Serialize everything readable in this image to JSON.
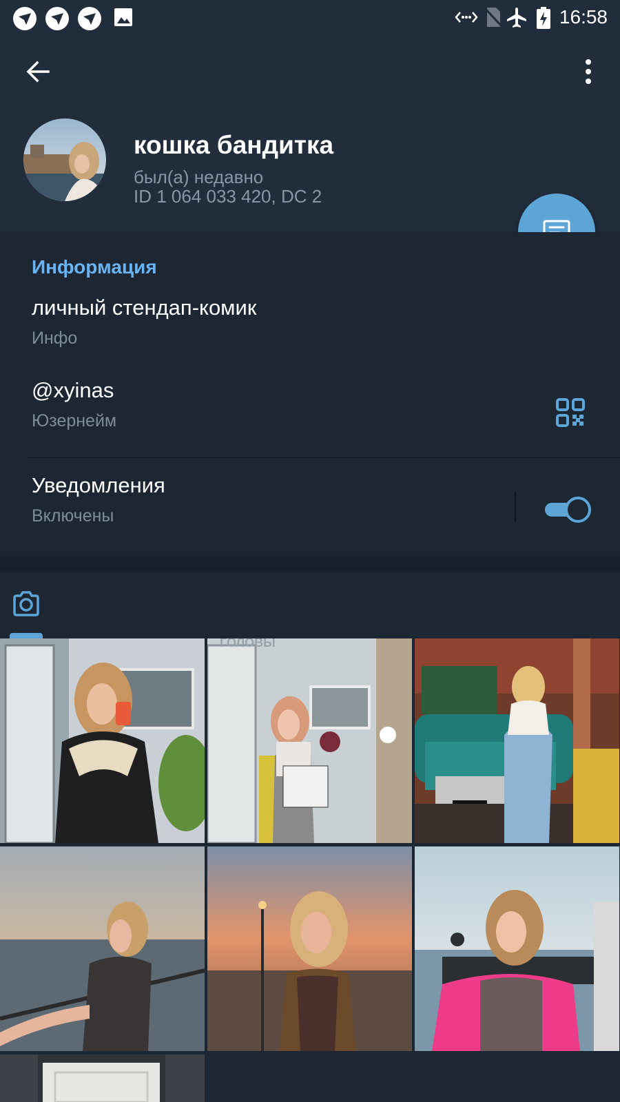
{
  "status_bar": {
    "time": "16:58",
    "icons": [
      "app-notification-icon",
      "app-notification-icon",
      "app-notification-icon",
      "image-icon",
      "data-transfer-icon",
      "no-sim-icon",
      "airplane-mode-icon",
      "battery-charging-icon"
    ]
  },
  "profile": {
    "name": "кошка бандитка",
    "status": "был(а) недавно",
    "id_line": "ID 1 064 033 420, DC 2"
  },
  "info": {
    "section_title": "Информация",
    "bio": "личный стендап-комик",
    "bio_label": "Инфо",
    "username": "@xyinas",
    "username_label": "Юзернейм",
    "notifications": "Уведомления",
    "notifications_status": "Включены",
    "notifications_enabled": true
  },
  "media": {
    "active_tab": "camera-icon",
    "photos": [
      {
        "kind": "mirror-selfie-salon"
      },
      {
        "kind": "mirror-selfie-shopping-bag",
        "caption_fragment": "ГОЛОВЫ"
      },
      {
        "kind": "vintage-car-museum"
      },
      {
        "kind": "sunset-river-railing"
      },
      {
        "kind": "sunset-embankment"
      },
      {
        "kind": "river-embankment-pink-jacket"
      },
      {
        "kind": "bathroom-door"
      }
    ]
  },
  "colors": {
    "accent": "#5ea5d7",
    "section_title": "#6ab3f3",
    "header_bg": "#212d3b",
    "page_bg": "#1d2733"
  }
}
